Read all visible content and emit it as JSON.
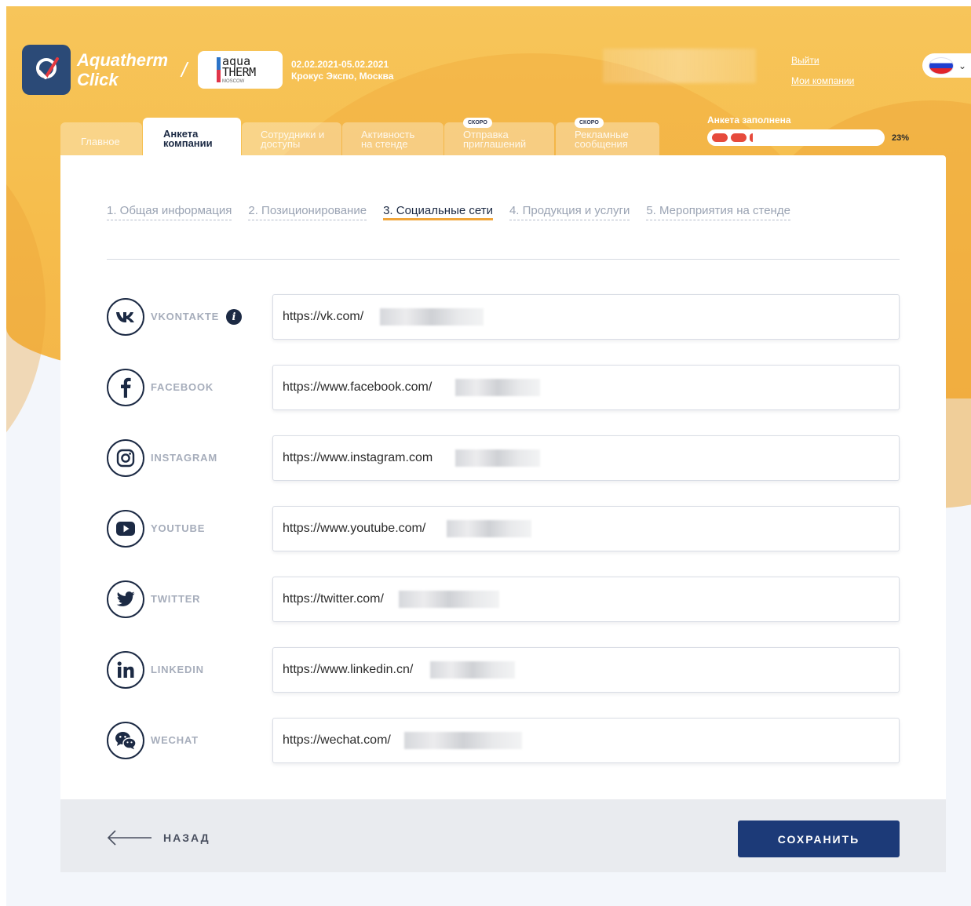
{
  "header": {
    "brand_line1": "Aquatherm",
    "brand_line2": "Click",
    "brand_slash": "/",
    "event_logo_line1": "aqua",
    "event_logo_line2": "THERM",
    "event_logo_line3": "MOSCOW",
    "event_dates": "02.02.2021-05.02.2021",
    "event_venue": "Крокус Экспо, Москва",
    "logout_label": "Выйти",
    "my_companies_label": "Мои компании",
    "language_flag": "ru-flag-icon",
    "lang_chevron": "⌄"
  },
  "tabs": [
    {
      "label": "Главное",
      "active": false,
      "soon": ""
    },
    {
      "label": "Анкета компании",
      "active": true,
      "soon": ""
    },
    {
      "label": "Сотрудники и доступы",
      "active": false,
      "soon": ""
    },
    {
      "label": "Активность на стенде",
      "active": false,
      "soon": ""
    },
    {
      "label": "Отправка приглашений",
      "active": false,
      "soon": "СКОРО"
    },
    {
      "label": "Рекламные сообщения",
      "active": false,
      "soon": "СКОРО"
    }
  ],
  "progress": {
    "label": "Анкета заполнена",
    "percent_text": "23%",
    "value": 0.23
  },
  "steps": [
    {
      "label": "1. Общая информация",
      "active": false
    },
    {
      "label": "2. Позиционирование",
      "active": false
    },
    {
      "label": "3. Социальные сети",
      "active": true
    },
    {
      "label": "4. Продукция и услуги",
      "active": false
    },
    {
      "label": "5. Мероприятия на стенде",
      "active": false
    }
  ],
  "social": [
    {
      "name": "VKONTAKTE",
      "icon": "vk-icon",
      "value": "https://vk.com/",
      "has_info": true
    },
    {
      "name": "FACEBOOK",
      "icon": "facebook-icon",
      "value": "https://www.facebook.com/",
      "has_info": false
    },
    {
      "name": "INSTAGRAM",
      "icon": "instagram-icon",
      "value": "https://www.instagram.com",
      "has_info": false
    },
    {
      "name": "YOUTUBE",
      "icon": "youtube-icon",
      "value": "https://www.youtube.com/",
      "has_info": false
    },
    {
      "name": "TWITTER",
      "icon": "twitter-icon",
      "value": "https://twitter.com/",
      "has_info": false
    },
    {
      "name": "LINKEDIN",
      "icon": "linkedin-icon",
      "value": "https://www.linkedin.cn/",
      "has_info": false
    },
    {
      "name": "WECHAT",
      "icon": "wechat-icon",
      "value": "https://wechat.com/",
      "has_info": false
    }
  ],
  "info_icon_glyph": "i",
  "footer": {
    "back_label": "НАЗАД",
    "save_label": "СОХРАНИТЬ"
  },
  "colors": {
    "hero": "#f6bd4c",
    "primary": "#1c3a78",
    "text_dark": "#1c2a44",
    "accent": "#f0a53a",
    "progress": "#e64a3c"
  }
}
